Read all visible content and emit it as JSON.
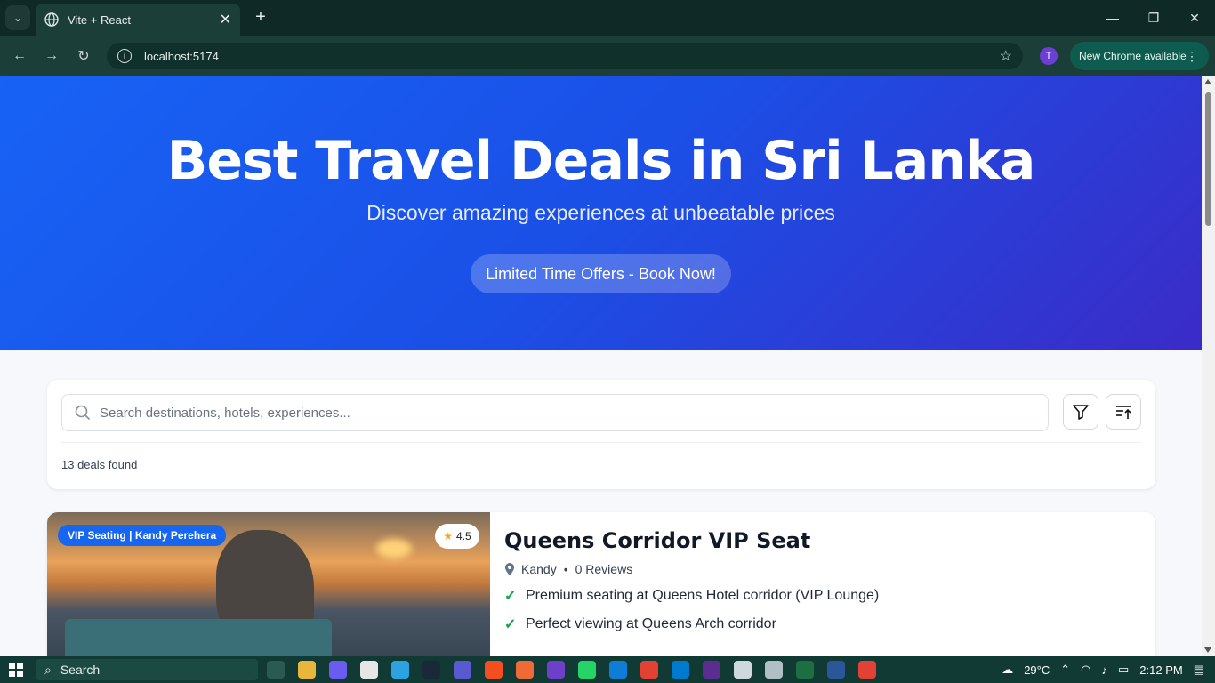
{
  "browser": {
    "tab_title": "Vite + React",
    "url": "localhost:5174",
    "new_chrome_label": "New Chrome available",
    "avatar_letter": "T"
  },
  "hero": {
    "title": "Best Travel Deals in Sri Lanka",
    "subtitle": "Discover amazing experiences at unbeatable prices",
    "cta_label": "Limited Time Offers - Book Now!"
  },
  "search": {
    "placeholder": "Search destinations, hotels, experiences...",
    "results_count": "13 deals found"
  },
  "deals": [
    {
      "badge": "VIP Seating | Kandy Perehera",
      "rating": "4.5",
      "title": "Queens Corridor VIP Seat",
      "location": "Kandy",
      "reviews": "0 Reviews",
      "features": [
        "Premium seating at Queens Hotel corridor (VIP Lounge)",
        "Perfect viewing at Queens Arch corridor"
      ]
    }
  ],
  "taskbar": {
    "search_label": "Search",
    "weather": "29°C",
    "time": "2:12 PM"
  }
}
